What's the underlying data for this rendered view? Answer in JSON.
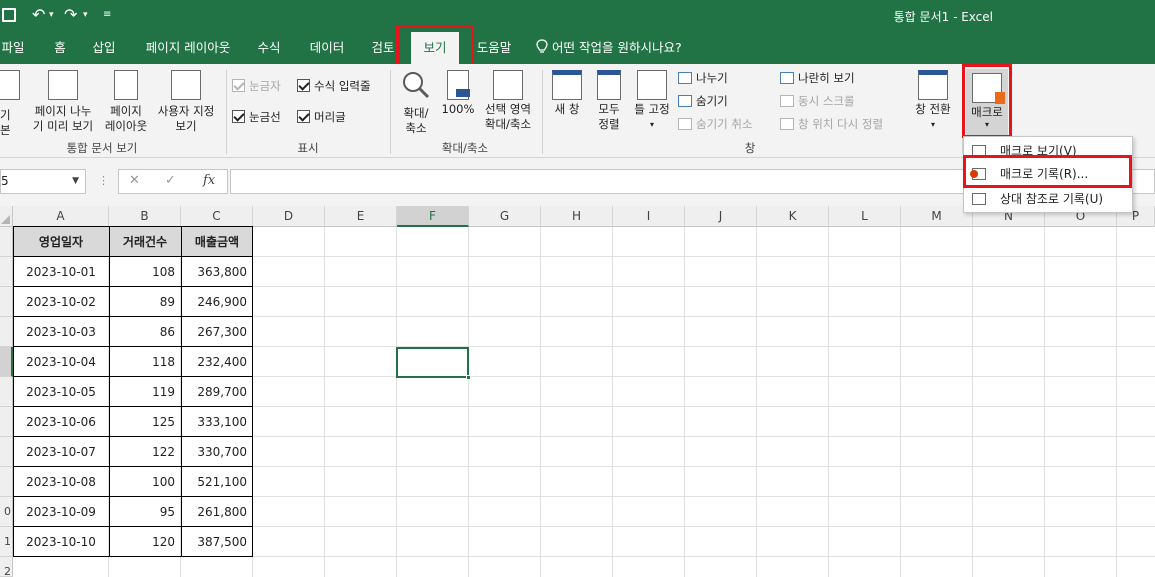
{
  "window": {
    "title": "통합 문서1  -  Excel",
    "qat": {
      "undo_arrow": "↶",
      "undo_caret": "▾",
      "redo_arrow": "↷",
      "redo_caret": "▾",
      "customize": "≡"
    }
  },
  "tabs": [
    {
      "label": "파일"
    },
    {
      "label": "홈"
    },
    {
      "label": "삽입"
    },
    {
      "label": "페이지 레이아웃"
    },
    {
      "label": "수식"
    },
    {
      "label": "데이터"
    },
    {
      "label": "검토"
    },
    {
      "label": "보기",
      "active": true
    },
    {
      "label": "도움말"
    }
  ],
  "tell_me": "어떤 작업을 원하시나요?",
  "ribbon": {
    "workbook_views": {
      "group_label": "통합 문서 보기",
      "normal": "기본",
      "page_break": [
        "페이지 나누",
        "기 미리 보기"
      ],
      "page_layout": [
        "페이지",
        "레이아웃"
      ],
      "custom": [
        "사용자 지정",
        "보기"
      ]
    },
    "show": {
      "group_label": "표시",
      "ruler": "눈금자",
      "formula_bar": "수식 입력줄",
      "gridlines": "눈금선",
      "headings": "머리글"
    },
    "zoom": {
      "group_label": "확대/축소",
      "zoom": [
        "확대/",
        "축소"
      ],
      "hundred": "100%",
      "zoom_selection": [
        "선택 영역",
        "확대/축소"
      ]
    },
    "window": {
      "group_label": "창",
      "new_window": "새 창",
      "arrange_all": [
        "모두",
        "정렬"
      ],
      "freeze": "틀 고정",
      "split": "나누기",
      "hide": "숨기기",
      "unhide": "숨기기 취소",
      "side_by_side": "나란히 보기",
      "sync_scroll": "동시 스크롤",
      "reset_position": "창 위치 다시 정렬",
      "switch_windows": "창 전환"
    },
    "macros": {
      "label": "매크로",
      "caret": "▾"
    }
  },
  "macro_menu": {
    "items": [
      {
        "label": "매크로 보기(V)"
      },
      {
        "label": "매크로 기록(R)..."
      },
      {
        "label": "상대 참조로 기록(U)"
      }
    ]
  },
  "formula_bar": {
    "name_box": "5",
    "cancel": "✕",
    "enter": "✓",
    "fx": "fx",
    "value": ""
  },
  "columns": [
    "A",
    "B",
    "C",
    "D",
    "E",
    "F",
    "G",
    "H",
    "I",
    "J",
    "K",
    "L",
    "M",
    "N",
    "O",
    "P"
  ],
  "rows": [
    "",
    "",
    "",
    "",
    "",
    "",
    "",
    "",
    "",
    "0",
    "1",
    "2"
  ],
  "table": {
    "headers": [
      "영업일자",
      "거래건수",
      "매출금액"
    ],
    "rows": [
      [
        "2023-10-01",
        "108",
        "363,800"
      ],
      [
        "2023-10-02",
        "89",
        "246,900"
      ],
      [
        "2023-10-03",
        "86",
        "267,300"
      ],
      [
        "2023-10-04",
        "118",
        "232,400"
      ],
      [
        "2023-10-05",
        "119",
        "289,700"
      ],
      [
        "2023-10-06",
        "125",
        "333,100"
      ],
      [
        "2023-10-07",
        "122",
        "330,700"
      ],
      [
        "2023-10-08",
        "100",
        "521,100"
      ],
      [
        "2023-10-09",
        "95",
        "261,800"
      ],
      [
        "2023-10-10",
        "120",
        "387,500"
      ]
    ]
  },
  "colors": {
    "excel_green": "#217346",
    "highlight_red": "#e8141c",
    "header_fill": "#d9d9d9"
  }
}
